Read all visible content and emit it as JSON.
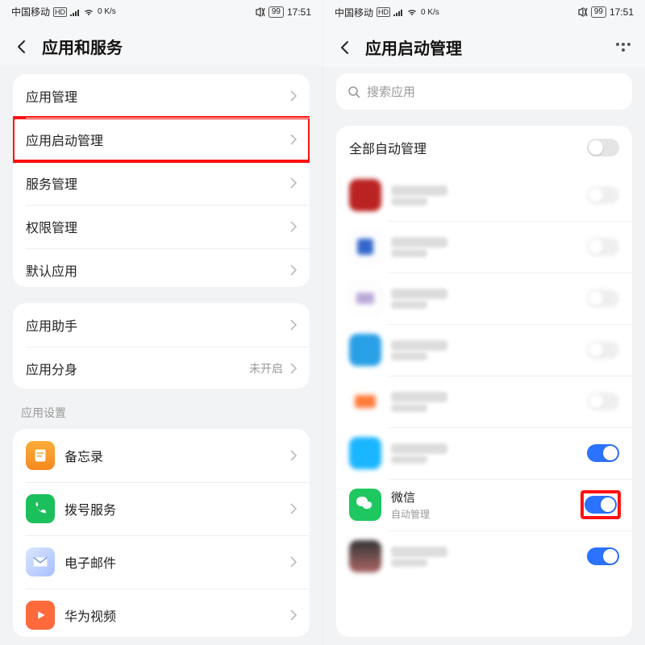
{
  "status": {
    "carrier": "中国移动",
    "net_hd": "HD",
    "net_sig": "⁴⁶",
    "speed": "0 K/s",
    "battery": "99",
    "time": "17:51"
  },
  "left": {
    "title": "应用和服务",
    "group1": [
      {
        "label": "应用管理"
      },
      {
        "label": "应用启动管理",
        "highlight": true
      },
      {
        "label": "服务管理"
      },
      {
        "label": "权限管理"
      },
      {
        "label": "默认应用"
      }
    ],
    "group2": [
      {
        "label": "应用助手"
      },
      {
        "label": "应用分身",
        "sub": "未开启"
      }
    ],
    "section_header": "应用设置",
    "apps": [
      {
        "label": "备忘录",
        "icon": "memo"
      },
      {
        "label": "拨号服务",
        "icon": "phone"
      },
      {
        "label": "电子邮件",
        "icon": "mail"
      },
      {
        "label": "华为视频",
        "icon": "video"
      }
    ]
  },
  "right": {
    "title": "应用启动管理",
    "search_placeholder": "搜索应用",
    "all_auto": "全部自动管理",
    "wechat": {
      "name": "微信",
      "desc": "自动管理"
    }
  }
}
